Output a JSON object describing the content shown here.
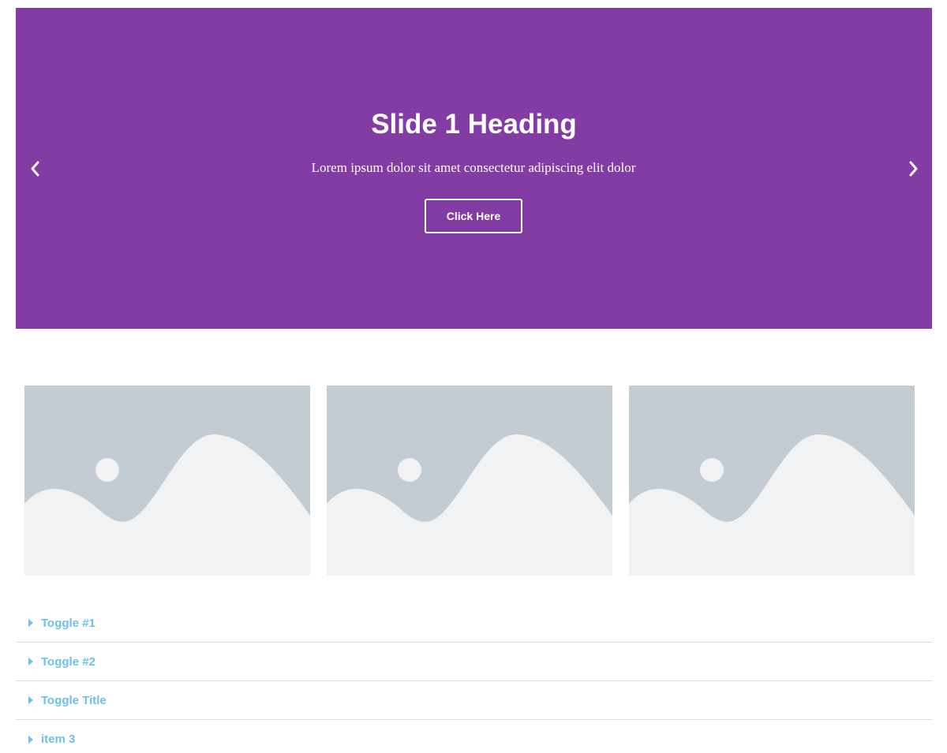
{
  "slider": {
    "heading": "Slide 1 Heading",
    "description": "Lorem ipsum dolor sit amet consectetur adipiscing elit dolor",
    "button_label": "Click Here",
    "prev_icon": "chevron-left-icon",
    "next_icon": "chevron-right-icon",
    "background_color": "#833ca3"
  },
  "gallery": {
    "items": [
      {
        "icon": "image-placeholder-icon"
      },
      {
        "icon": "image-placeholder-icon"
      },
      {
        "icon": "image-placeholder-icon"
      }
    ],
    "placeholder_bg": "#c3cbd3",
    "placeholder_fg": "#f1f2f4"
  },
  "toggles": {
    "items": [
      {
        "title": "Toggle #1"
      },
      {
        "title": "Toggle #2"
      },
      {
        "title": "Toggle Title"
      },
      {
        "title": "item 3"
      }
    ],
    "accent_color": "#6ec1e4",
    "caret_icon": "caret-right-icon"
  }
}
